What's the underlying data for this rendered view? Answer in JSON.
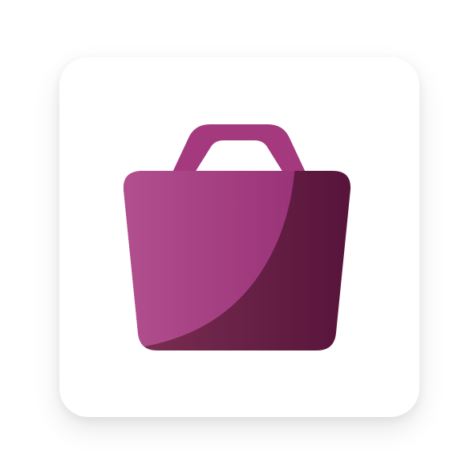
{
  "app_icon": {
    "icon_name": "shopping-bag-icon",
    "colors": {
      "tile_background": "#ffffff",
      "bag_light_start": "#b2508f",
      "bag_light_end": "#9a3378",
      "bag_dark_start": "#7d3054",
      "bag_dark_end": "#56133a",
      "handle": "#a4397e"
    }
  }
}
